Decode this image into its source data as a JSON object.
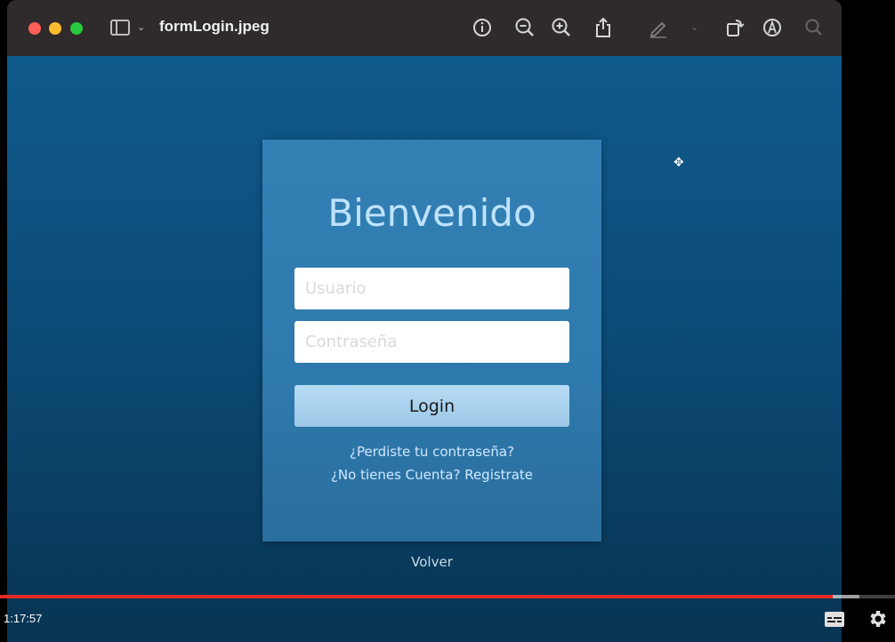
{
  "window": {
    "title": "formLogin.jpeg",
    "toolbar_icons": [
      "sidebar-toggle-icon",
      "info-icon",
      "zoom-out-icon",
      "zoom-in-icon",
      "share-icon",
      "markup-pen-icon",
      "chevron-down-icon",
      "rotate-icon",
      "markup-toolbar-icon",
      "search-icon"
    ]
  },
  "login": {
    "heading": "Bienvenido",
    "username_placeholder": "Usuario",
    "password_placeholder": "Contraseña",
    "login_label": "Login",
    "forgot_link": "¿Perdiste tu contraseña?",
    "register_link": "¿No tienes Cuenta? Registrate",
    "back_link": "Volver"
  },
  "player": {
    "time": "1:17:57",
    "progress": 0.93,
    "buffered": 0.96
  },
  "colors": {
    "background": "#0f5a8c",
    "card": "#3380b5",
    "heading": "#bfe3ff",
    "login_button": "#b7dcf5",
    "progress_played": "#e52d27"
  }
}
